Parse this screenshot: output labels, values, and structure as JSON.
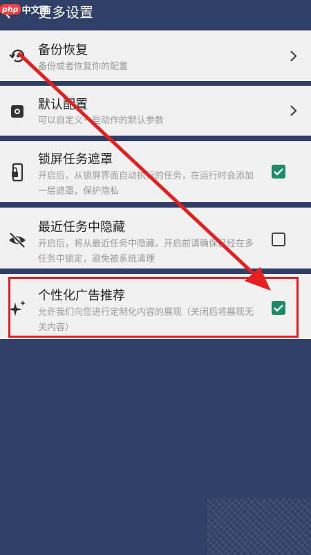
{
  "watermark": {
    "logo": "php",
    "text": "中文网"
  },
  "header": {
    "title": "更多设置"
  },
  "items": [
    {
      "title": "备份恢复",
      "subtitle": "备份或者恢复你的配置",
      "icon": "restore-icon",
      "control": "chevron"
    },
    {
      "title": "默认配置",
      "subtitle": "可以自定义一些动作的默认参数",
      "icon": "settings-icon",
      "control": "chevron"
    },
    {
      "title": "锁屏任务遮罩",
      "subtitle": "开启后，从锁屏界面自动执行的任务，在运行时会添加一层遮罩，保护隐私",
      "icon": "lock-screen-icon",
      "control": "checkbox",
      "checked": true
    },
    {
      "title": "最近任务中隐藏",
      "subtitle": "开启后，将从最近任务中隐藏。开启前请确保已经在多任务中锁定，避免被系统清理",
      "icon": "visibility-off-icon",
      "control": "checkbox",
      "checked": false
    },
    {
      "title": "个性化广告推荐",
      "subtitle": "允许我们向您进行定制化内容的展现（关闭后将展现无关内容）",
      "icon": "sparkle-icon",
      "control": "checkbox",
      "checked": true
    }
  ],
  "colors": {
    "header_bg": "#2f3f65",
    "card_bg": "#f1f1f1",
    "check": "#1e8a67",
    "annotation": "#e31f1f"
  }
}
